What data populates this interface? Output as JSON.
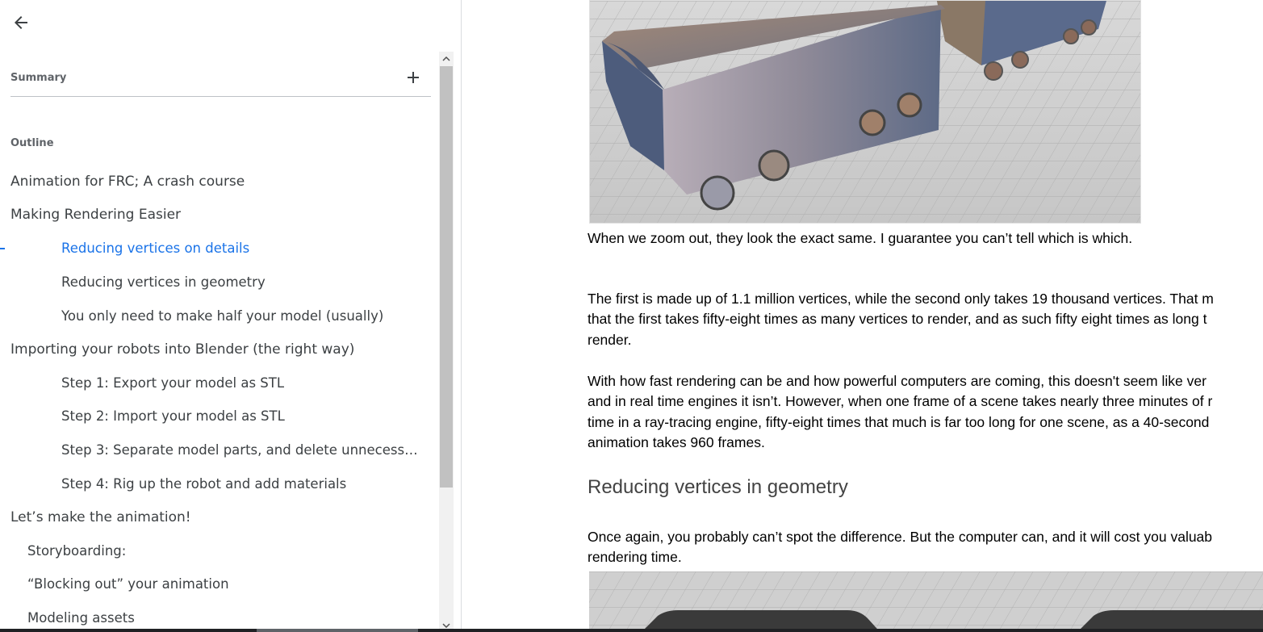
{
  "sidebar": {
    "back_icon": "arrow-back-icon",
    "summary_label": "Summary",
    "add_icon": "plus-icon",
    "outline_label": "Outline",
    "items": [
      {
        "label": "Animation for FRC; A crash course",
        "level": 1
      },
      {
        "label": "Making Rendering Easier",
        "level": 1
      },
      {
        "label": "Reducing vertices on details",
        "level": 3,
        "active": true
      },
      {
        "label": "Reducing vertices in geometry",
        "level": 3
      },
      {
        "label": "You only need to make half your model (usually)",
        "level": 3
      },
      {
        "label": "Importing your robots into Blender (the right way)",
        "level": 1
      },
      {
        "label": "Step 1: Export your model as STL",
        "level": 3
      },
      {
        "label": "Step 2: Import your model as STL",
        "level": 3
      },
      {
        "label": "Step 3: Separate model parts, and delete unnecess…",
        "level": 3
      },
      {
        "label": "Step 4: Rig up the robot and add materials",
        "level": 3
      },
      {
        "label": "Let’s make the animation!",
        "level": 1
      },
      {
        "label": "Storyboarding:",
        "level": 2
      },
      {
        "label": "“Blocking out” your animation",
        "level": 2
      },
      {
        "label": "Modeling assets",
        "level": 2
      }
    ],
    "accent_color": "#1a73e8"
  },
  "document": {
    "caption": "When we zoom out, they look the exact same. I guarantee you can’t tell which is which.",
    "para1": [
      "The first is made up of 1.1 million vertices, while the second only takes 19 thousand vertices. That m",
      "that the first takes fifty-eight times as many vertices to render, and as such fifty eight times as long t",
      "render."
    ],
    "para2": [
      "With how fast rendering can be and how powerful computers are coming, this doesn't seem like ver",
      "and in real time engines it isn’t. However, when one frame of a scene takes nearly three minutes of r",
      "time in a ray-tracing engine, fifty-eight times that much is far too long for one scene, as a 40-second",
      "animation takes 960 frames."
    ],
    "heading": "Reducing vertices in geometry",
    "para3": [
      "Once again, you probably can’t spot the difference. But the computer can, and it will cost you valuab",
      "rendering time."
    ]
  }
}
